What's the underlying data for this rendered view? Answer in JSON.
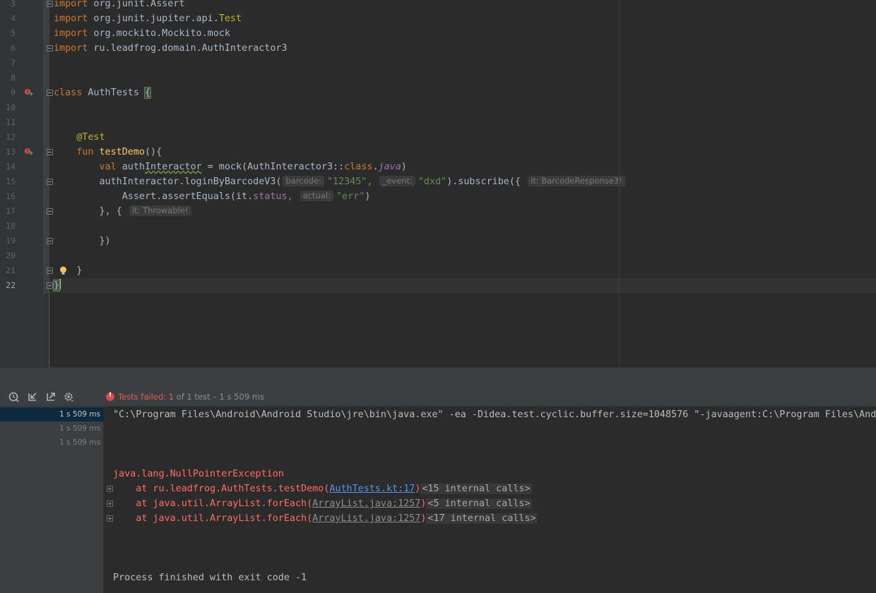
{
  "editor": {
    "lines": [
      {
        "n": "3",
        "segs": [
          {
            "c": "kw",
            "t": "import"
          },
          {
            "c": "",
            "t": " org.junit.Assert"
          }
        ]
      },
      {
        "n": "4",
        "segs": [
          {
            "c": "kw",
            "t": "import"
          },
          {
            "c": "",
            "t": " org.junit.jupiter.api."
          },
          {
            "c": "ann",
            "t": "Test"
          }
        ]
      },
      {
        "n": "5",
        "segs": [
          {
            "c": "kw",
            "t": "import"
          },
          {
            "c": "",
            "t": " org.mockito.Mockito.mock"
          }
        ]
      },
      {
        "n": "6",
        "segs": [
          {
            "c": "kw",
            "t": "import"
          },
          {
            "c": "",
            "t": " ru.leadfrog.domain.AuthInteractor3"
          }
        ]
      },
      {
        "n": "7",
        "segs": []
      },
      {
        "n": "8",
        "segs": []
      },
      {
        "n": "9",
        "segs": [
          {
            "c": "kw",
            "t": "class"
          },
          {
            "c": "",
            "t": " AuthTests "
          },
          {
            "c": "brace-hl",
            "t": "{"
          }
        ]
      },
      {
        "n": "10",
        "segs": []
      },
      {
        "n": "11",
        "segs": []
      },
      {
        "n": "12",
        "segs": [
          {
            "c": "",
            "t": "    "
          },
          {
            "c": "ann",
            "t": "@Test"
          }
        ]
      },
      {
        "n": "13",
        "segs": [
          {
            "c": "",
            "t": "    "
          },
          {
            "c": "kw",
            "t": "fun"
          },
          {
            "c": "",
            "t": " "
          },
          {
            "c": "fn",
            "t": "testDemo"
          },
          {
            "c": "",
            "t": "(){"
          }
        ]
      },
      {
        "n": "14",
        "segs": [
          {
            "c": "",
            "t": "        "
          },
          {
            "c": "kw",
            "t": "val"
          },
          {
            "c": "",
            "t": " auth"
          },
          {
            "c": "warn-ul",
            "t": "Interactor"
          },
          {
            "c": "",
            "t": " = mock(AuthInteractor3::"
          },
          {
            "c": "kw",
            "t": "class"
          },
          {
            "c": "",
            "t": "."
          },
          {
            "c": "ital",
            "t": "java"
          },
          {
            "c": "",
            "t": ")"
          }
        ]
      },
      {
        "n": "15",
        "segs": [
          {
            "c": "",
            "t": "        authInteractor.loginByBarcodeV3("
          },
          {
            "c": "hint",
            "t": "barcode:"
          },
          {
            "c": "str",
            "t": "\"12345\""
          },
          {
            "c": "kw",
            "t": ","
          },
          {
            "c": "",
            "t": " "
          },
          {
            "c": "hint",
            "t": "_event:"
          },
          {
            "c": "str",
            "t": "\"dxd\""
          },
          {
            "c": "",
            "t": ").subscribe({ "
          },
          {
            "c": "hint",
            "t": "it: BarcodeResponse3!"
          }
        ]
      },
      {
        "n": "16",
        "segs": [
          {
            "c": "",
            "t": "            Assert.assertEquals(it."
          },
          {
            "c": "prop",
            "t": "status"
          },
          {
            "c": "kw",
            "t": ","
          },
          {
            "c": "",
            "t": " "
          },
          {
            "c": "hint",
            "t": "actual:"
          },
          {
            "c": "str",
            "t": "\"err\""
          },
          {
            "c": "",
            "t": ")"
          }
        ]
      },
      {
        "n": "17",
        "segs": [
          {
            "c": "",
            "t": "        }, { "
          },
          {
            "c": "hint",
            "t": "it: Throwable!"
          }
        ]
      },
      {
        "n": "18",
        "segs": []
      },
      {
        "n": "19",
        "segs": [
          {
            "c": "",
            "t": "        })"
          }
        ]
      },
      {
        "n": "20",
        "segs": []
      },
      {
        "n": "21",
        "segs": [
          {
            "c": "",
            "t": "    }"
          }
        ]
      },
      {
        "n": "22",
        "segs": [
          {
            "c": "brace-hl",
            "t": "}"
          }
        ]
      }
    ]
  },
  "run_panel": {
    "status_failed": "Tests failed: 1",
    "status_rest": " of 1 test – 1 s 509 ms",
    "tree": [
      {
        "duration": "1 s 509 ms",
        "selected": true
      },
      {
        "duration": "1 s 509 ms",
        "selected": false
      },
      {
        "duration": "1 s 509 ms",
        "selected": false
      }
    ],
    "console": {
      "command": "\"C:\\Program Files\\Android\\Android Studio\\jre\\bin\\java.exe\" -ea -Didea.test.cyclic.buffer.size=1048576 \"-javaagent:C:\\Program Files\\Andr",
      "exception": "java.lang.NullPointerException",
      "stack": [
        {
          "prefix": "    at ru.leadfrog.AuthTests.testDemo(",
          "link": "AuthTests.kt:17",
          "link_style": "link",
          "internal": "<15 internal calls>"
        },
        {
          "prefix": "    at java.util.ArrayList.forEach(",
          "link": "ArrayList.java:1257",
          "link_style": "glink",
          "internal": "<5 internal calls>"
        },
        {
          "prefix": "    at java.util.ArrayList.forEach(",
          "link": "ArrayList.java:1257",
          "link_style": "glink",
          "internal": "<17 internal calls>"
        }
      ],
      "finished": "Process finished with exit code -1"
    }
  },
  "colors": {
    "keyword": "#cc7832",
    "string": "#6a8759",
    "annotation": "#bbb529",
    "error": "#ff6b68",
    "link": "#5394ec"
  }
}
